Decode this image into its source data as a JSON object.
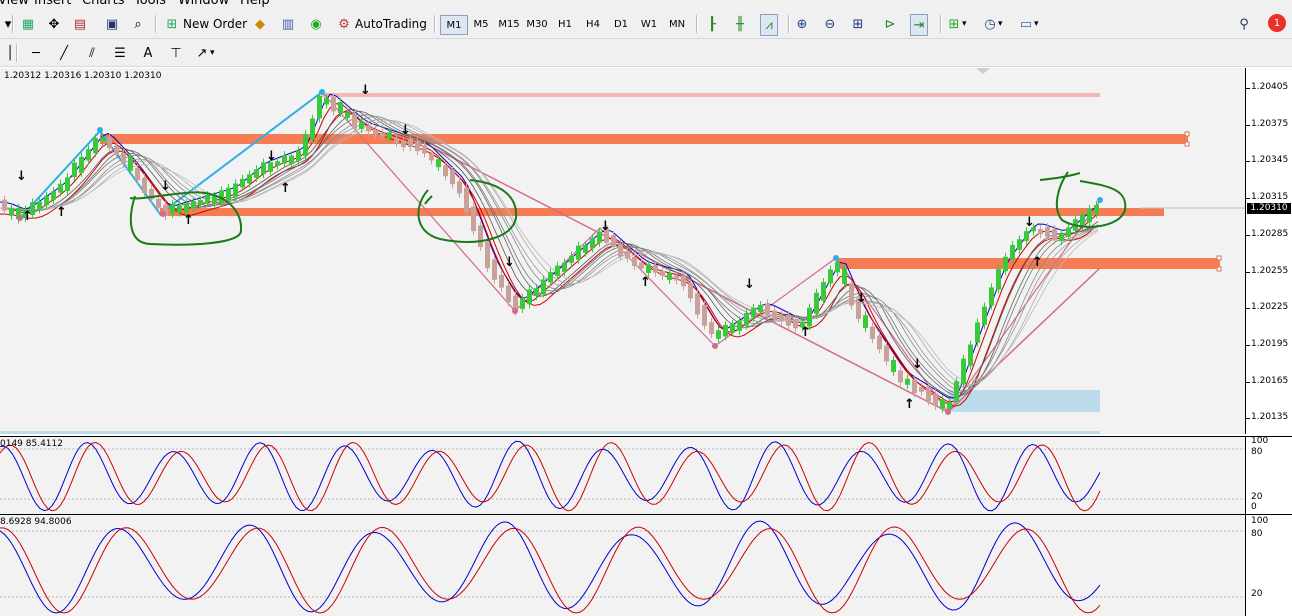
{
  "menu": [
    "View",
    "Insert",
    "Charts",
    "Tools",
    "Window",
    "Help"
  ],
  "toolbar": {
    "new_order": "New Order",
    "autotrading": "AutoTrading",
    "timeframes": [
      "M1",
      "M5",
      "M15",
      "M30",
      "H1",
      "H4",
      "D1",
      "W1",
      "MN"
    ],
    "active_timeframe": "M1",
    "notification_count": "1",
    "text_tool": "A"
  },
  "chart": {
    "info": "1.20312 1.20316 1.20310 1.20310",
    "current_price": "1.20310",
    "price_ticks": [
      "1.20405",
      "1.20375",
      "1.20345",
      "1.20315",
      "1.20285",
      "1.20255",
      "1.20225",
      "1.20195",
      "1.20165",
      "1.20135"
    ],
    "colors": {
      "bull": "#3cc83c",
      "bear": "#c9a19b",
      "zone": "#f57c53",
      "blue_line": "#0000cc",
      "red_line": "#cc0000",
      "annotation": "#1a7a1a"
    }
  },
  "stoch1": {
    "info": "0149 85.4112",
    "levels": [
      "100",
      "80",
      "20",
      "0"
    ]
  },
  "stoch2": {
    "info": "8.6928 94.8006",
    "levels": [
      "100",
      "80",
      "20"
    ]
  }
}
